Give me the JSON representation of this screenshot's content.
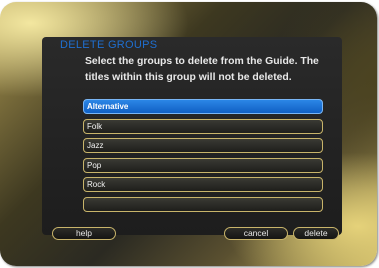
{
  "dialog": {
    "title": "DELETE GROUPS",
    "instructions": [
      "Select the groups to delete from the Guide. The",
      "titles within this group will not be deleted."
    ]
  },
  "groups": [
    {
      "label": "Alternative",
      "selected": true
    },
    {
      "label": "Folk",
      "selected": false
    },
    {
      "label": "Jazz",
      "selected": false
    },
    {
      "label": "Pop",
      "selected": false
    },
    {
      "label": "Rock",
      "selected": false
    },
    {
      "label": "",
      "selected": false
    }
  ],
  "buttons": {
    "help": "help",
    "cancel": "cancel",
    "delete": "delete"
  },
  "colors": {
    "title": "#1f6fd0",
    "selection": "#1a72d6",
    "border": "#c8b46a"
  }
}
